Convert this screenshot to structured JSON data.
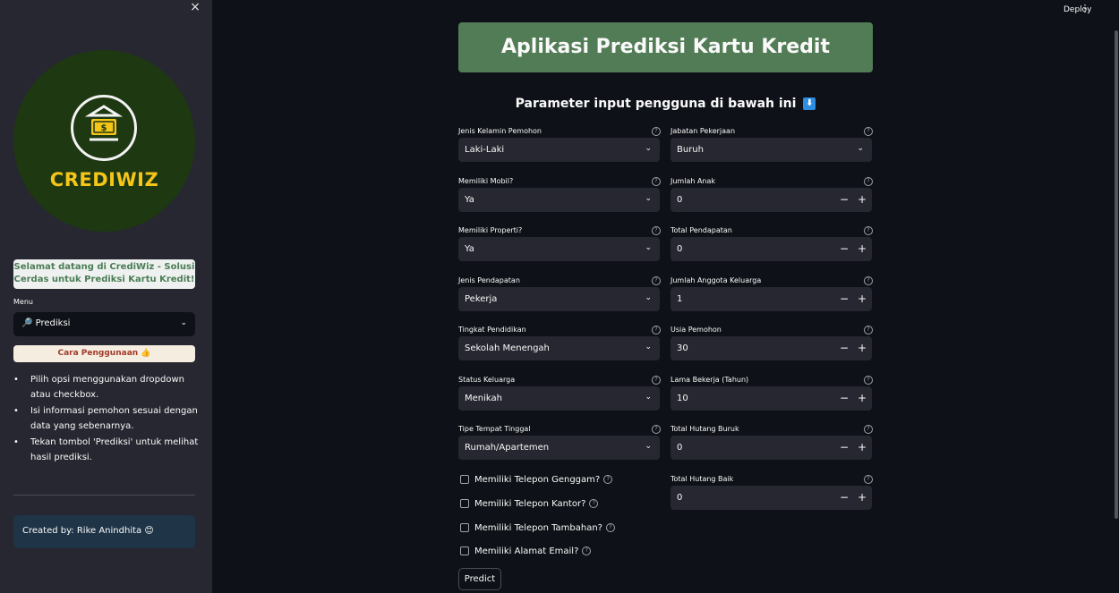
{
  "app": {
    "deploy_label": "Deploy",
    "title": "Aplikasi Prediksi Kartu Kredit",
    "subtitle": "Parameter input pengguna di bawah ini",
    "subtitle_icon": "⬇"
  },
  "sidebar": {
    "close_icon": "×",
    "logo_text": "CREDIWIZ",
    "welcome_line1": "Selamat datang di CrediWiz - Solusi",
    "welcome_line2": "Cerdas untuk Prediksi Kartu Kredit!",
    "menu_label": "Menu",
    "menu_value": "🔎 Prediksi",
    "cara_button": "Cara Penggunaan 👍",
    "tips": [
      "Pilih opsi menggunakan dropdown atau checkbox.",
      "Isi informasi pemohon sesuai dengan data yang sebenarnya.",
      "Tekan tombol 'Prediksi' untuk melihat hasil prediksi."
    ],
    "created_by": "Created by: Rike Anindhita 😊"
  },
  "form": {
    "left": [
      {
        "label": "Jenis Kelamin Pemohon",
        "value": "Laki-Laki"
      },
      {
        "label": "Memiliki Mobil?",
        "value": "Ya"
      },
      {
        "label": "Memiliki Properti?",
        "value": "Ya"
      },
      {
        "label": "Jenis Pendapatan",
        "value": "Pekerja"
      },
      {
        "label": "Tingkat Pendidikan",
        "value": "Sekolah Menengah"
      },
      {
        "label": "Status Keluarga",
        "value": "Menikah"
      },
      {
        "label": "Tipe Tempat Tinggal",
        "value": "Rumah/Apartemen"
      }
    ],
    "right": [
      {
        "label": "Jabatan Pekerjaan",
        "value": "Buruh"
      },
      {
        "label": "Jumlah Anak",
        "value": "0"
      },
      {
        "label": "Total Pendapatan",
        "value": "0"
      },
      {
        "label": "Jumlah Anggota Keluarga",
        "value": "1"
      },
      {
        "label": "Usia Pemohon",
        "value": "30"
      },
      {
        "label": "Lama Bekerja (Tahun)",
        "value": "10"
      },
      {
        "label": "Total Hutang Buruk",
        "value": "0"
      },
      {
        "label": "Total Hutang Baik",
        "value": "0"
      }
    ],
    "checkboxes": [
      "Memiliki Telepon Genggam?",
      "Memiliki Telepon Kantor?",
      "Memiliki Telepon Tambahan?",
      "Memiliki Alamat Email?"
    ],
    "predict_label": "Predict"
  }
}
